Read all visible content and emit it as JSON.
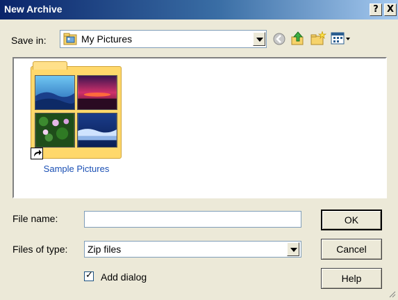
{
  "window": {
    "title": "New Archive",
    "help_glyph": "?",
    "close_glyph": "X"
  },
  "save_in": {
    "label": "Save in:",
    "value": "My Pictures",
    "folder_icon": "my-pictures-folder-icon"
  },
  "toolbar": {
    "icons": [
      "back-icon",
      "up-folder-icon",
      "new-folder-icon",
      "view-menu-icon"
    ]
  },
  "files": [
    {
      "name": "Sample Pictures",
      "icon": "folder-shortcut-icon"
    }
  ],
  "file_name": {
    "label": "File name:",
    "value": ""
  },
  "file_type": {
    "label": "Files of type:",
    "value": "Zip files"
  },
  "add_dialog": {
    "label": "Add dialog",
    "checked": true
  },
  "buttons": {
    "ok": "OK",
    "cancel": "Cancel",
    "help": "Help"
  }
}
